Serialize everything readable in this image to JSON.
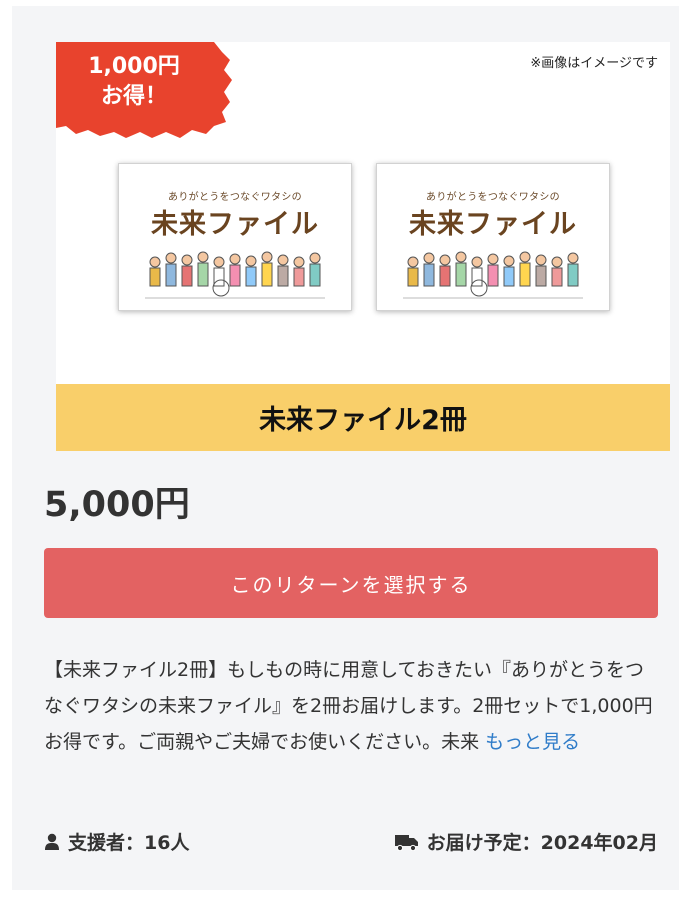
{
  "badge": {
    "line1": "1,000円",
    "line2": "お得！"
  },
  "image_note": "※画像はイメージです",
  "books": [
    {
      "subtitle": "ありがとうをつなぐワタシの",
      "title": "未来ファイル"
    },
    {
      "subtitle": "ありがとうをつなぐワタシの",
      "title": "未来ファイル"
    }
  ],
  "reward": {
    "title": "未来ファイル2冊",
    "price": "5,000円",
    "select_label": "このリターンを選択する",
    "description": "【未来ファイル2冊】もしもの時に用意しておきたい『ありがとうをつなぐワタシの未来ファイル』を2冊お届けします。2冊セットで1,000円お得です。ご両親やご夫婦でお使いください。未来",
    "more_label": "もっと見る"
  },
  "footer": {
    "supporters": "支援者：16人",
    "delivery": "お届け予定：2024年02月"
  },
  "colors": {
    "badge": "#e8432d",
    "banner": "#f9cf6a",
    "button": "#e36262",
    "link": "#2f7cc9",
    "card_bg": "#f4f5f7"
  },
  "icons": {
    "supporters": "user-icon",
    "delivery": "truck-icon"
  }
}
